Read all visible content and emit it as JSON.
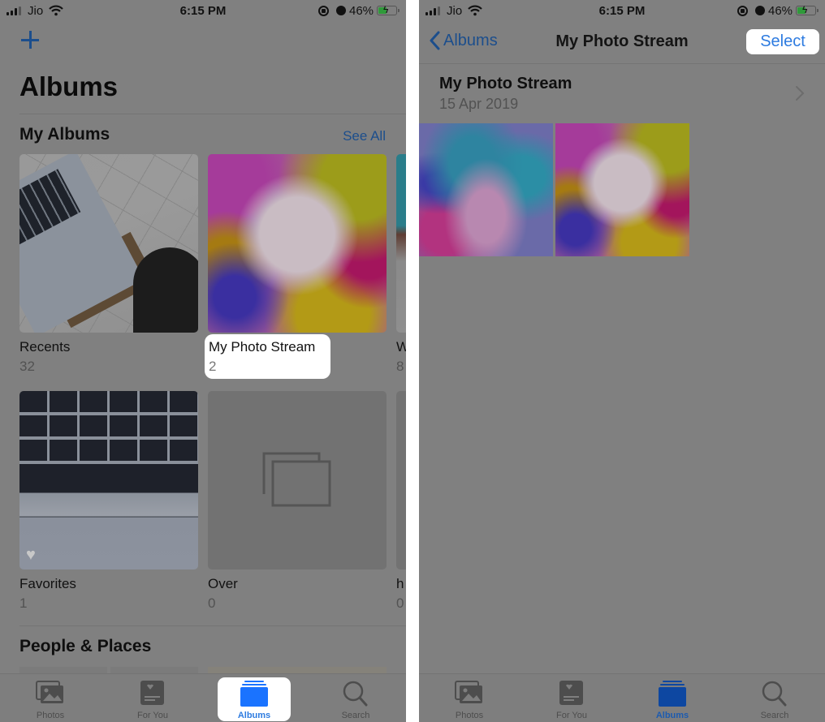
{
  "status_bar": {
    "carrier": "Jio",
    "time": "6:15 PM",
    "battery_percent": "46%",
    "battery_level": 0.46,
    "icons": [
      "signal-icon",
      "wifi-icon",
      "orientation-lock-icon",
      "alarm-icon",
      "battery-charging-icon"
    ]
  },
  "left_screen": {
    "add_icon": "plus-icon",
    "title": "Albums",
    "my_albums": {
      "heading": "My Albums",
      "see_all": "See All",
      "albums": [
        {
          "name": "Recents",
          "count": "32"
        },
        {
          "name": "My Photo Stream",
          "count": "2",
          "highlighted": true
        },
        {
          "name": "W",
          "count": "8"
        },
        {
          "name": "Favorites",
          "count": "1"
        },
        {
          "name": "Over",
          "count": "0"
        },
        {
          "name": "h",
          "count": "0"
        }
      ]
    },
    "people_places": {
      "heading": "People & Places"
    }
  },
  "right_screen": {
    "back_label": "Albums",
    "nav_title": "My Photo Stream",
    "select_label": "Select",
    "stream": {
      "title": "My Photo Stream",
      "date": "15 Apr 2019",
      "photo_count": 2
    }
  },
  "tab_bar": {
    "tabs": [
      {
        "label": "Photos",
        "icon": "photos-icon"
      },
      {
        "label": "For You",
        "icon": "for-you-icon"
      },
      {
        "label": "Albums",
        "icon": "albums-icon",
        "active": true
      },
      {
        "label": "Search",
        "icon": "search-icon"
      }
    ]
  },
  "colors": {
    "accent": "#2d7be0",
    "dimmed_accent": "#1c4e8c",
    "overlay_bg": "#808080",
    "highlight": "#ffffff"
  }
}
